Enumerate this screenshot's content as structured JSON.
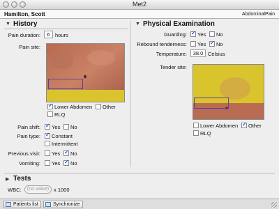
{
  "window": {
    "title": "Met2"
  },
  "header": {
    "patient": "Hamilton, Scott",
    "condition": "AbdominalPain"
  },
  "history": {
    "title": "History",
    "pain_duration": {
      "label": "Pain duration:",
      "value": "6",
      "unit": "hours"
    },
    "pain_site": {
      "label": "Pain site:",
      "options": [
        {
          "label": "Lower Abdomen",
          "checked": true
        },
        {
          "label": "Other",
          "checked": false
        },
        {
          "label": "RLQ",
          "checked": false
        }
      ]
    },
    "pain_shift": {
      "label": "Pain shift:",
      "yes_label": "Yes",
      "no_label": "No",
      "yes": true,
      "no": false
    },
    "pain_type": {
      "label": "Pain type:",
      "constant_label": "Constant",
      "intermittent_label": "Intermittent",
      "constant": true,
      "intermittent": false
    },
    "previous_visit": {
      "label": "Previous visit:",
      "yes_label": "Yes",
      "no_label": "No",
      "yes": false,
      "no": true
    },
    "vomiting": {
      "label": "Vomiting:",
      "yes_label": "Yes",
      "no_label": "No",
      "yes": false,
      "no": true
    }
  },
  "physical": {
    "title": "Physical Examination",
    "guarding": {
      "label": "Guarding:",
      "yes_label": "Yes",
      "no_label": "No",
      "yes": true,
      "no": false
    },
    "rebound": {
      "label": "Rebound tenderness:",
      "yes_label": "Yes",
      "no_label": "No",
      "yes": false,
      "no": true
    },
    "temperature": {
      "label": "Temperature:",
      "value": "38.0",
      "unit": "Celsius"
    },
    "tender_site": {
      "label": "Tender site:",
      "options": [
        {
          "label": "Lower Abdomen",
          "checked": false
        },
        {
          "label": "Other",
          "checked": true
        },
        {
          "label": "RLQ",
          "checked": false
        }
      ]
    }
  },
  "tests": {
    "title": "Tests",
    "wbc": {
      "label": "WBC:",
      "placeholder": "(no value)",
      "unit": "x 1000"
    }
  },
  "bottom": {
    "patients_list": "Patients list",
    "synchronize": "Synchronize"
  },
  "icons": {
    "collapse": "triangle-down-icon",
    "patients": "folder-icon",
    "sync": "sync-icon"
  },
  "colors": {
    "check": "#1a5ed6",
    "highlight_yellow": "#d9c42e",
    "region_outline": "#5a3fa0"
  }
}
